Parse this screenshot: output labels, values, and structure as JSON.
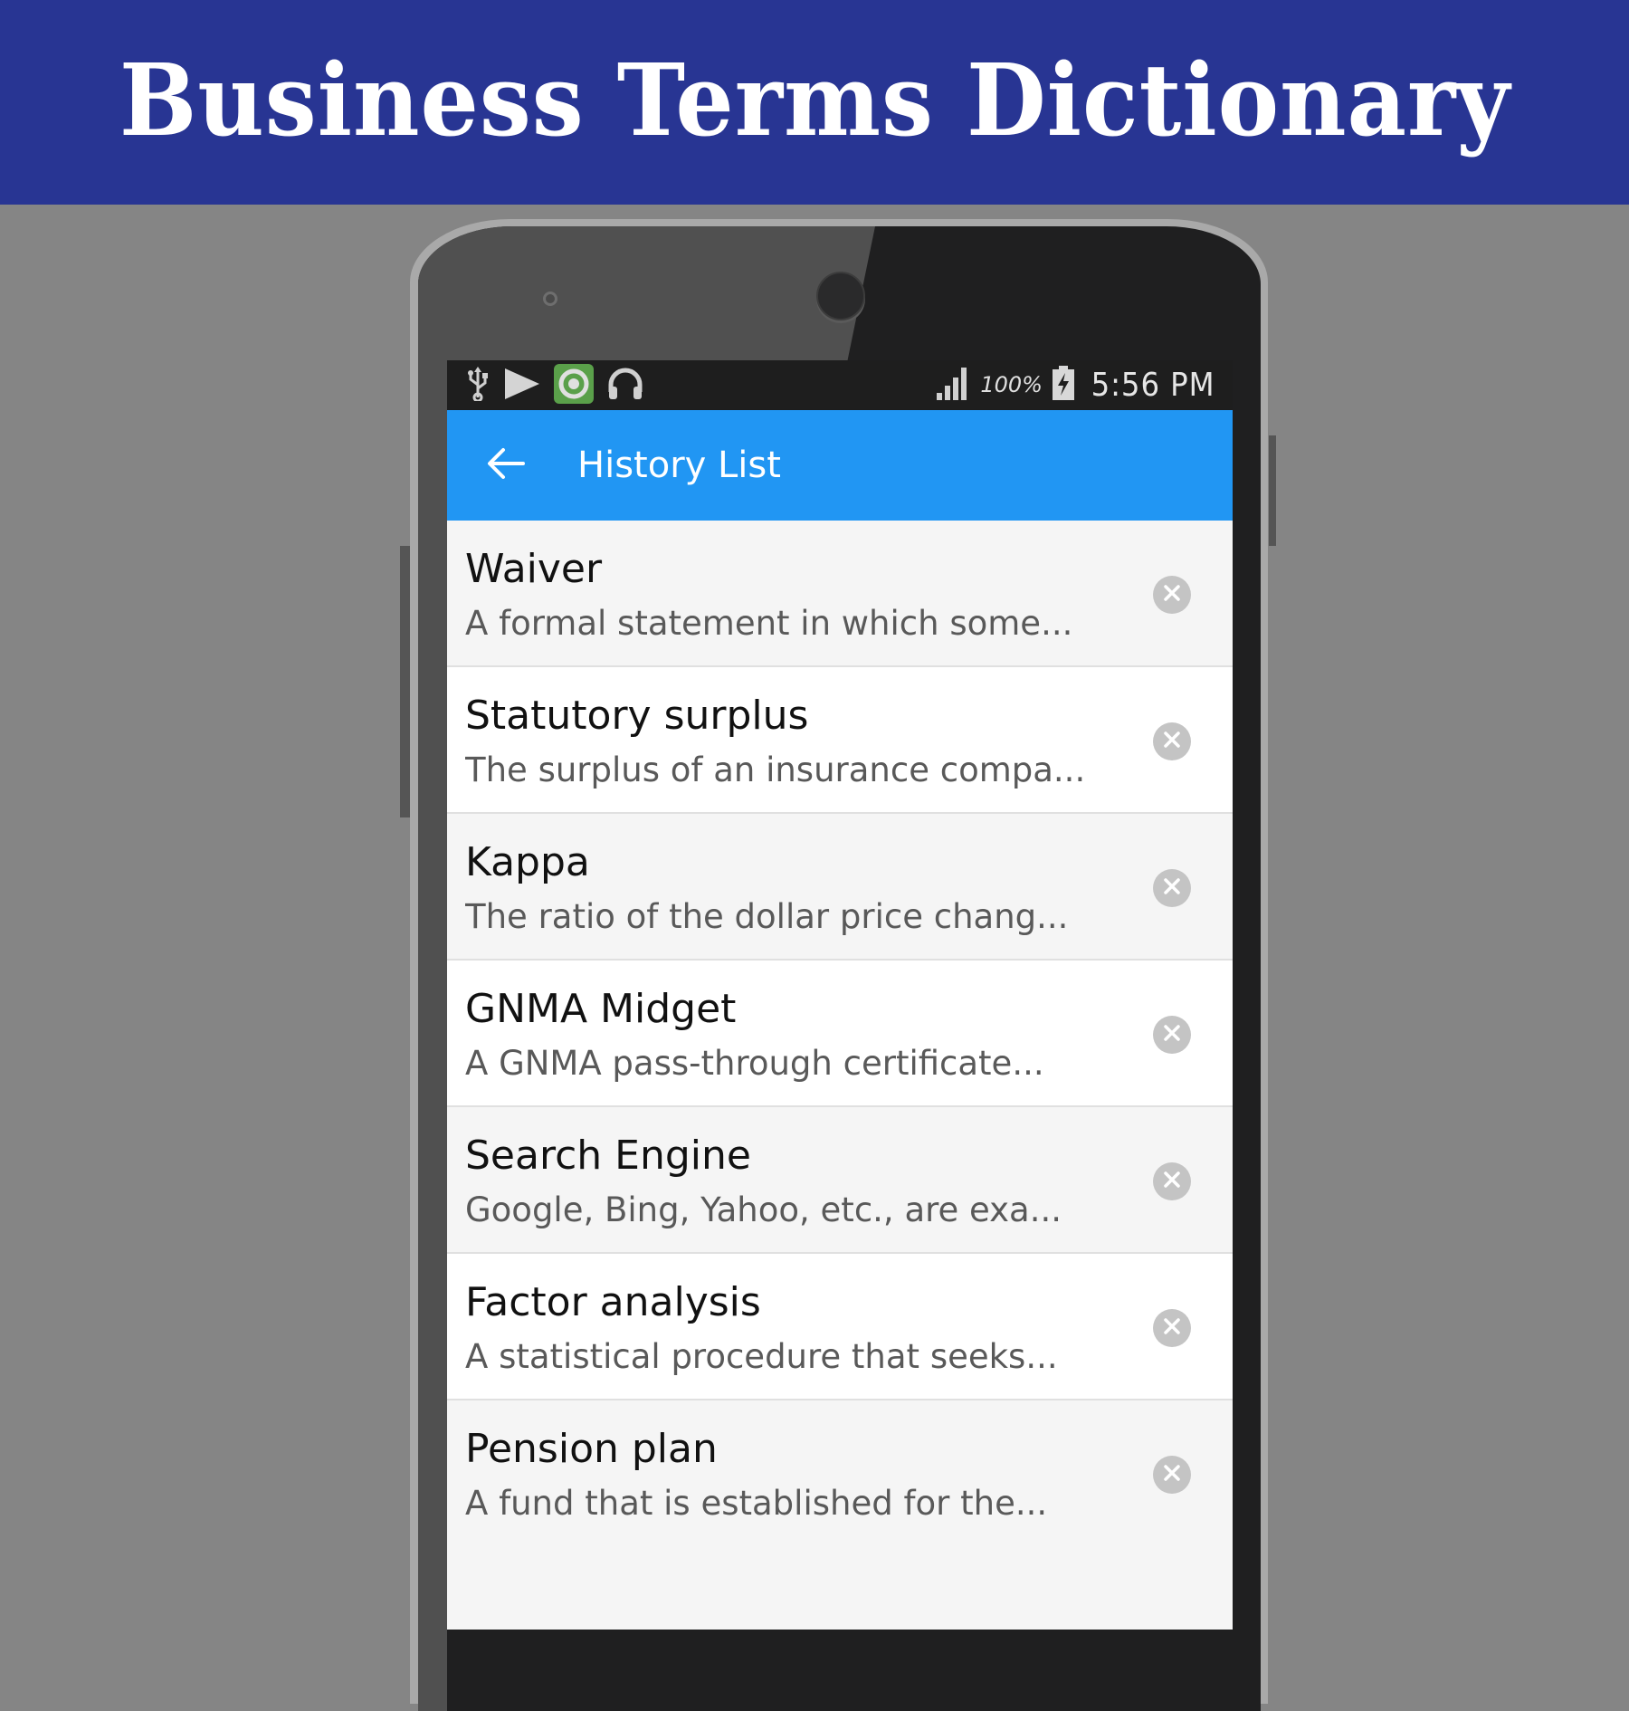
{
  "banner": {
    "title": "Business Terms Dictionary"
  },
  "status_bar": {
    "left_icons": [
      "usb-icon",
      "play-store-icon",
      "app-notification-icon",
      "headphones-icon"
    ],
    "signal_icon": "signal-icon",
    "battery_percent": "100%",
    "battery_icon": "battery-charging-icon",
    "time": "5:56 PM"
  },
  "app_bar": {
    "back_icon": "arrow-left-icon",
    "title": "History List",
    "color": "#2196F3"
  },
  "history": [
    {
      "term": "Waiver",
      "definition": "A formal statement in which some..."
    },
    {
      "term": "Statutory surplus",
      "definition": "The surplus of an insurance compa..."
    },
    {
      "term": "Kappa",
      "definition": "The ratio of the dollar price chang..."
    },
    {
      "term": "GNMA Midget",
      "definition": "A GNMA pass-through certificate..."
    },
    {
      "term": "Search Engine",
      "definition": "Google, Bing, Yahoo, etc., are exa..."
    },
    {
      "term": "Factor analysis",
      "definition": "A statistical procedure that seeks..."
    },
    {
      "term": "Pension plan",
      "definition": "A fund that is established for the..."
    }
  ],
  "row_action_icon": "remove-circle-x-icon",
  "colors": {
    "banner": "#283593",
    "app_bar": "#2196F3",
    "status_bar": "#1E1E1E",
    "background": "#858585"
  }
}
